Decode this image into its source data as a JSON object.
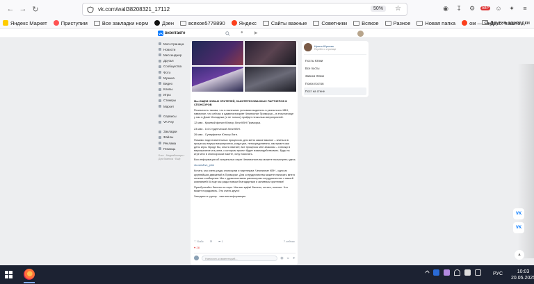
{
  "browser": {
    "url": "vk.com/wall38208321_17112",
    "zoom": "50%"
  },
  "bookmarks": {
    "items": [
      {
        "label": "Яндекс Маркет",
        "color": "#ffcc00"
      },
      {
        "label": "Приступим",
        "color": "#ff5252"
      },
      {
        "label": "Все закладки норм",
        "color": "#888888"
      },
      {
        "label": "Дзен",
        "color": "#111111"
      },
      {
        "label": "всякое5778890",
        "color": "#888888"
      },
      {
        "label": "Яндекс",
        "color": "#fc3f1d"
      },
      {
        "label": "Сайты важные",
        "color": "#888888"
      },
      {
        "label": "Советники",
        "color": "#888888"
      },
      {
        "label": "Всякое",
        "color": "#888888"
      },
      {
        "label": "Разное",
        "color": "#888888"
      },
      {
        "label": "Новая папка",
        "color": "#888888"
      },
      {
        "label": "ом — Яндекс: нашло...",
        "color": "#fc3f1d"
      }
    ],
    "other": "Другие закладки"
  },
  "vk": {
    "logo": "вконтакте",
    "leftnav": [
      "Моя страница",
      "Новости",
      "Мессенджер",
      "Друзья",
      "Сообщества",
      "Фото",
      "Музыка",
      "Видео",
      "Клипы",
      "Игры",
      "Стикеры",
      "Маркет"
    ],
    "leftnav2": [
      "Сервисы",
      "VK Pay"
    ],
    "leftnav3": [
      "Закладки",
      "Файлы",
      "Реклама",
      "Помощь"
    ],
    "footer": "Блог · Медиаблогеры · Для бизнеса · Ещё"
  },
  "post": {
    "paragraphs": [
      "Мы ИЩЕМ НОВЫХ ЗРИТЕЛЕЙ, ЗАИНТЕРЕСОВАННЫХ ПАРТНЕРОВ И СПОНСОРОВ",
      "Реальность такова, что в нынешних условиях выделить в реальность КВН, наверное, что сейчас и администрирует Чемпионат Приморья – в этом месяце у нас в Доме Молодежи (и не только) пройдет несколько мероприятий.",
      "12 мая - Краевой финал Юниор Лиги КВН Приморья.",
      "23 мая - 1/4 Студенческой Лиги КВН.",
      "26 мая - Суперфинал Юниор Лиги.",
      "Помимо подготовительных процессов, для меня самое важное – влиться в процессы внутри мероприятия, когда уже, непосредственно, наступает сам день игры. Вроде бы, опыта хватает, все процессы мне знакомы – я вхожу в мероприятие и в ритм, с которым проект будет взаимодействовать. Будь на игре или в спонсорском пакете, хочу помогать.",
      "Вся информация об актуальных играх Чемпионата вы можете посмотреть здесь",
      "vk.com/kvn_prim",
      "Кстати, мы очень рады спонсорам и партнерам. Чемпионат КВН - одно из крупнейших движений в Приморье. Для сотрудничества можете написать мне в личные сообщения. Мы с удовольствием рассмотрим сотрудничество с вашей компанией! А еще мы рады новым благодарным и активным зрителям!",
      "Приобретайте билеты на игры. Мы вас ждём! Билеты, кстати, полные. Что может порадовать. Это очень круто!",
      "Заходите в группу - там вся информация"
    ],
    "link_index": 7,
    "actions": [
      "Нравится",
      "Комментарии",
      "Поделиться"
    ],
    "likes_count": "Бабс",
    "views": "7 сейчас",
    "likes_line": "28",
    "comment_placeholder": "Написать комментарий..."
  },
  "right": {
    "owner_name": "Ирина Юрьева",
    "owner_sub": "Перейти к странице",
    "items": [
      "Посты Юлии",
      "Все посты",
      "Записи Юлии",
      "Поиск постов",
      "Пост на стене"
    ],
    "active_index": 4
  },
  "side_actions": [
    "VK",
    "VK"
  ],
  "taskbar": {
    "lang": "РУС",
    "time": "10:03",
    "date": "20.05.2025"
  }
}
